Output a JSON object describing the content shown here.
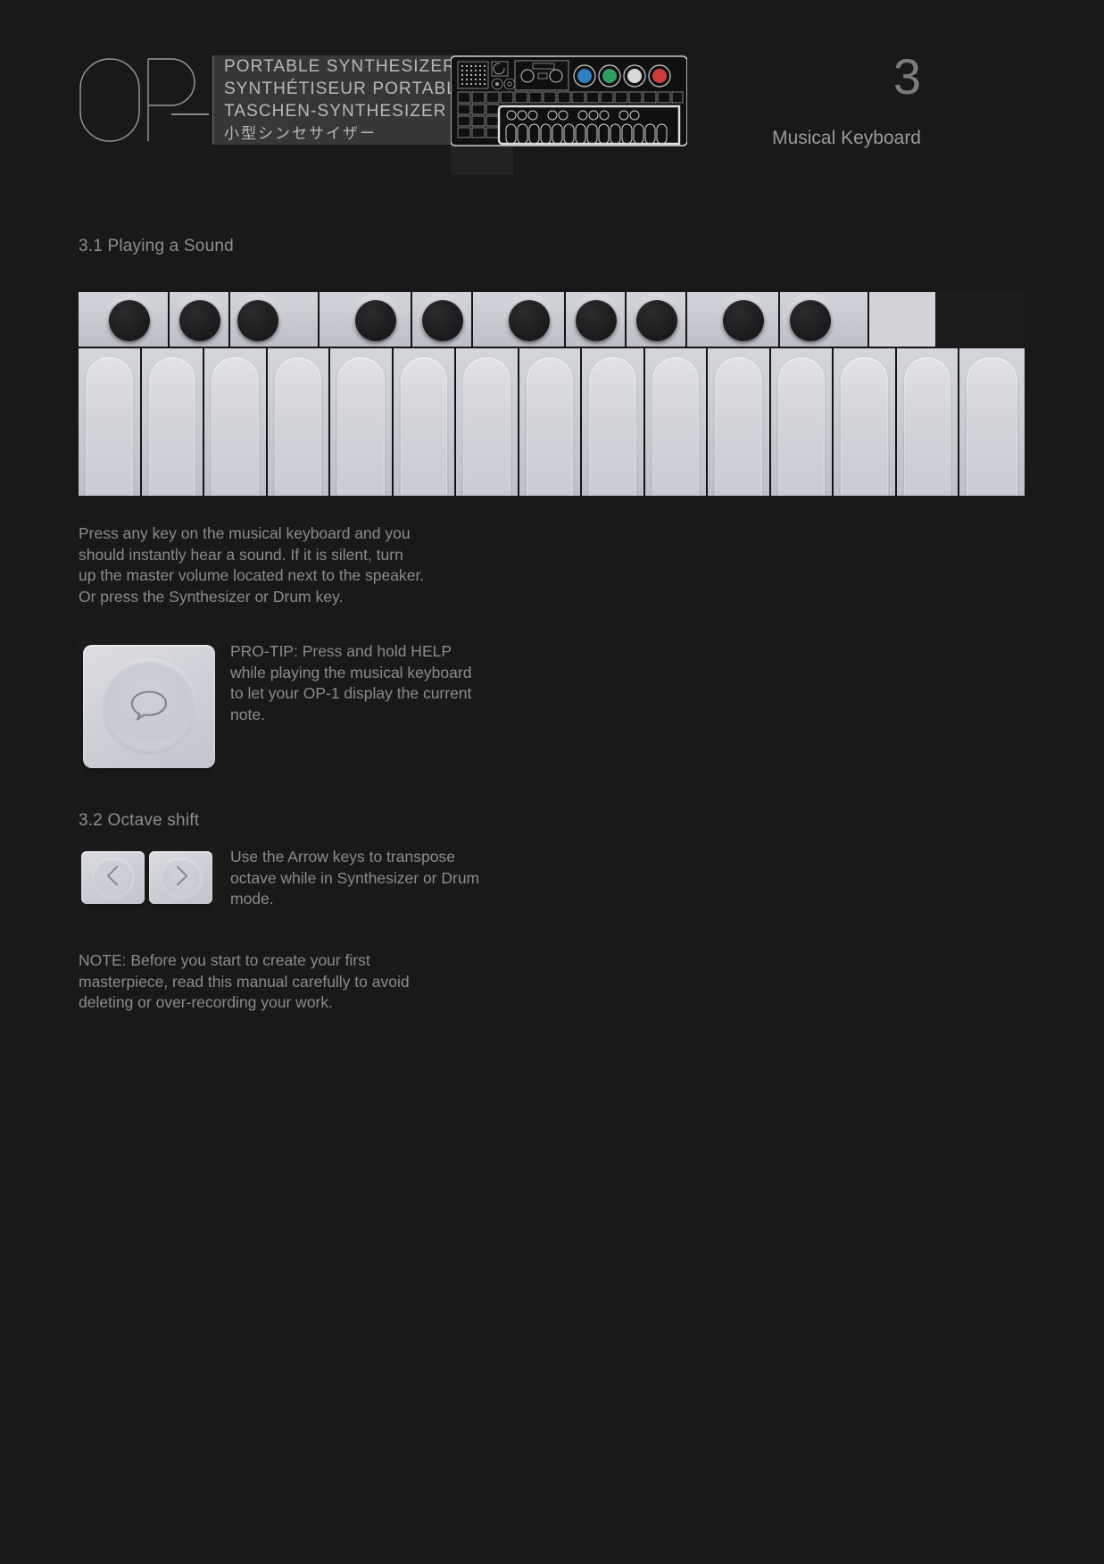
{
  "page": {
    "background_color": "#191919",
    "text_color": "#8b8b8b"
  },
  "header": {
    "logo_wordmark": "OP—",
    "subtitle_lines": [
      "PORTABLE SYNTHESIZER",
      "SYNTHÉTISEUR PORTABLE",
      "TASCHEN-SYNTHESIZER",
      "小型シンセサイザー"
    ],
    "chapter_number": "3",
    "chapter_title": "Musical Keyboard",
    "device_image_name": "op-1-device-schematic",
    "device_encoder_colors": [
      "#2f7fc4",
      "#2f9e63",
      "#d8d8d8",
      "#cf3b3b"
    ]
  },
  "sections": [
    {
      "id": "3.1",
      "heading": "3.1 Playing a Sound",
      "body": "Press any key on the musical keyboard and you\nshould instantly hear a sound. If it is silent, turn\nup the master volume located next to the speaker.\nOr press the Synthesizer or Drum key.",
      "tip": "PRO-TIP: Press and hold HELP\nwhile playing the musical keyboard\nto let your OP-1 display the current\nnote."
    },
    {
      "id": "3.2",
      "heading": "3.2 Octave shift",
      "body": "Use the Arrow keys to transpose\noctave while in Synthesizer or Drum\nmode."
    }
  ],
  "note": "NOTE: Before you start to create your first\nmasterpiece, read this manual carefully to avoid\ndeleting or over-recording your work.",
  "keyboard": {
    "image_name": "musical-keyboard-photo",
    "white_key_count": 15,
    "black_key_count": 10,
    "black_key_group_pattern": [
      2,
      3,
      2,
      3
    ],
    "white_key_color": "#ccced5",
    "black_key_color": "#1d1d1f"
  },
  "help_button": {
    "label": "HELP",
    "icon": "speech-bubble-icon"
  },
  "arrow_buttons": [
    {
      "label": "octave-down",
      "icon": "chevron-left-icon"
    },
    {
      "label": "octave-up",
      "icon": "chevron-right-icon"
    }
  ]
}
